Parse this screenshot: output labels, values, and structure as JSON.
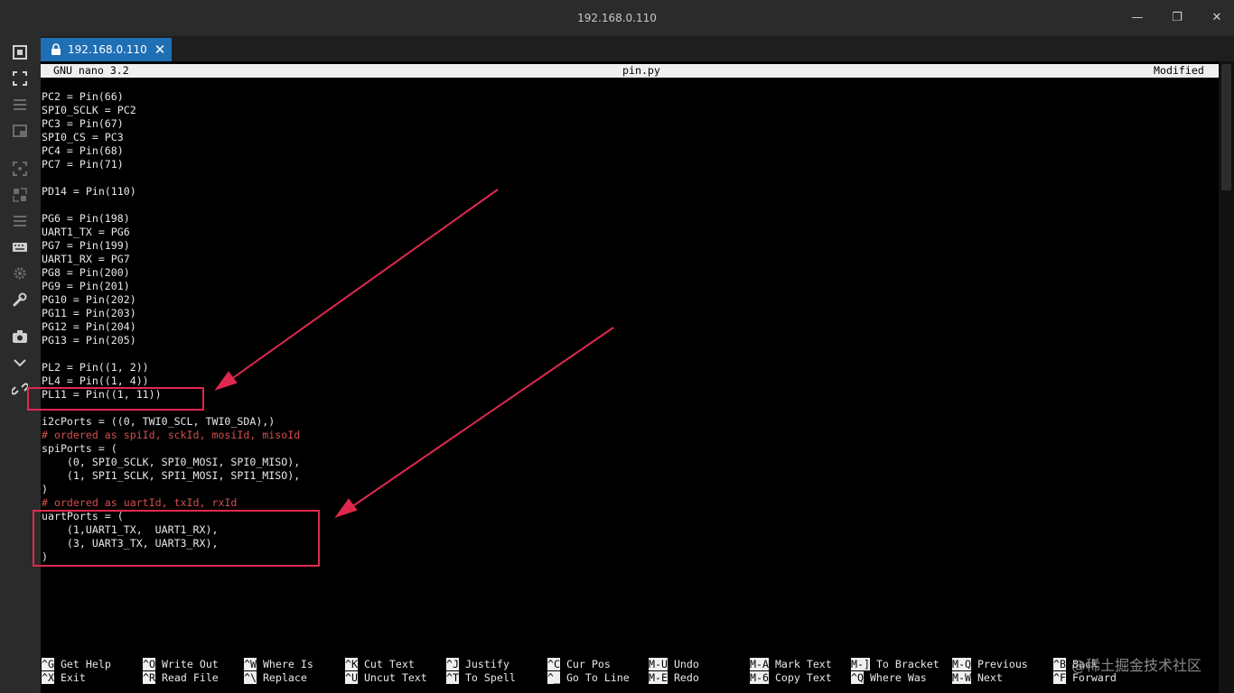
{
  "window": {
    "title": "192.168.0.110"
  },
  "tab": {
    "label": "192.168.0.110"
  },
  "nano": {
    "version": "GNU nano 3.2",
    "filename": "pin.py",
    "status": "Modified"
  },
  "code_lines": [
    {
      "text": "PC2 = Pin(66)",
      "comment": false
    },
    {
      "text": "SPI0_SCLK = PC2",
      "comment": false
    },
    {
      "text": "PC3 = Pin(67)",
      "comment": false
    },
    {
      "text": "SPI0_CS = PC3",
      "comment": false
    },
    {
      "text": "PC4 = Pin(68)",
      "comment": false
    },
    {
      "text": "PC7 = Pin(71)",
      "comment": false
    },
    {
      "text": "",
      "comment": false
    },
    {
      "text": "PD14 = Pin(110)",
      "comment": false
    },
    {
      "text": "",
      "comment": false
    },
    {
      "text": "PG6 = Pin(198)",
      "comment": false
    },
    {
      "text": "UART1_TX = PG6",
      "comment": false
    },
    {
      "text": "PG7 = Pin(199)",
      "comment": false
    },
    {
      "text": "UART1_RX = PG7",
      "comment": false
    },
    {
      "text": "PG8 = Pin(200)",
      "comment": false
    },
    {
      "text": "PG9 = Pin(201)",
      "comment": false
    },
    {
      "text": "PG10 = Pin(202)",
      "comment": false
    },
    {
      "text": "PG11 = Pin(203)",
      "comment": false
    },
    {
      "text": "PG12 = Pin(204)",
      "comment": false
    },
    {
      "text": "PG13 = Pin(205)",
      "comment": false
    },
    {
      "text": "",
      "comment": false
    },
    {
      "text": "PL2 = Pin((1, 2))",
      "comment": false
    },
    {
      "text": "PL4 = Pin((1, 4))",
      "comment": false
    },
    {
      "text": "PL11 = Pin((1, 11))",
      "comment": false
    },
    {
      "text": "",
      "comment": false
    },
    {
      "text": "i2cPorts = ((0, TWI0_SCL, TWI0_SDA),)",
      "comment": false
    },
    {
      "text": "# ordered as spiId, sckId, mosiId, misoId",
      "comment": true
    },
    {
      "text": "spiPorts = (",
      "comment": false
    },
    {
      "text": "    (0, SPI0_SCLK, SPI0_MOSI, SPI0_MISO),",
      "comment": false
    },
    {
      "text": "    (1, SPI1_SCLK, SPI1_MOSI, SPI1_MISO),",
      "comment": false
    },
    {
      "text": ")",
      "comment": false
    },
    {
      "text": "# ordered as uartId, txId, rxId",
      "comment": true
    },
    {
      "text": "uartPorts = (",
      "comment": false
    },
    {
      "text": "    (1,UART1_TX,  UART1_RX),",
      "comment": false
    },
    {
      "text": "    (3, UART3_TX, UART3_RX),",
      "comment": false
    },
    {
      "text": ")",
      "comment": false
    }
  ],
  "shortcuts": [
    {
      "key": "^G",
      "label": "Get Help"
    },
    {
      "key": "^X",
      "label": "Exit"
    },
    {
      "key": "^O",
      "label": "Write Out"
    },
    {
      "key": "^R",
      "label": "Read File"
    },
    {
      "key": "^W",
      "label": "Where Is"
    },
    {
      "key": "^\\",
      "label": "Replace"
    },
    {
      "key": "^K",
      "label": "Cut Text"
    },
    {
      "key": "^U",
      "label": "Uncut Text"
    },
    {
      "key": "^J",
      "label": "Justify"
    },
    {
      "key": "^T",
      "label": "To Spell"
    },
    {
      "key": "^C",
      "label": "Cur Pos"
    },
    {
      "key": "^_",
      "label": "Go To Line"
    },
    {
      "key": "M-U",
      "label": "Undo"
    },
    {
      "key": "M-E",
      "label": "Redo"
    },
    {
      "key": "M-A",
      "label": "Mark Text"
    },
    {
      "key": "M-6",
      "label": "Copy Text"
    },
    {
      "key": "M-]",
      "label": "To Bracket"
    },
    {
      "key": "^Q",
      "label": "Where Was"
    },
    {
      "key": "M-Q",
      "label": "Previous"
    },
    {
      "key": "M-W",
      "label": "Next"
    },
    {
      "key": "^B",
      "label": "Back"
    },
    {
      "key": "^F",
      "label": "Forward"
    }
  ],
  "watermark": "@稀土掘金技术社区",
  "colors": {
    "annotation": "#e0284f",
    "tab": "#1f6fb5",
    "comment": "#d24e4e"
  },
  "sidebar_icons": [
    "screenshot-icon",
    "fullscreen-icon",
    "menu-icon",
    "window-icon",
    "focus-icon",
    "scale-icon",
    "list-icon",
    "keyboard-icon",
    "settings-icon",
    "wrench-icon",
    "camera-icon",
    "chevron-down-icon",
    "unlink-icon"
  ]
}
